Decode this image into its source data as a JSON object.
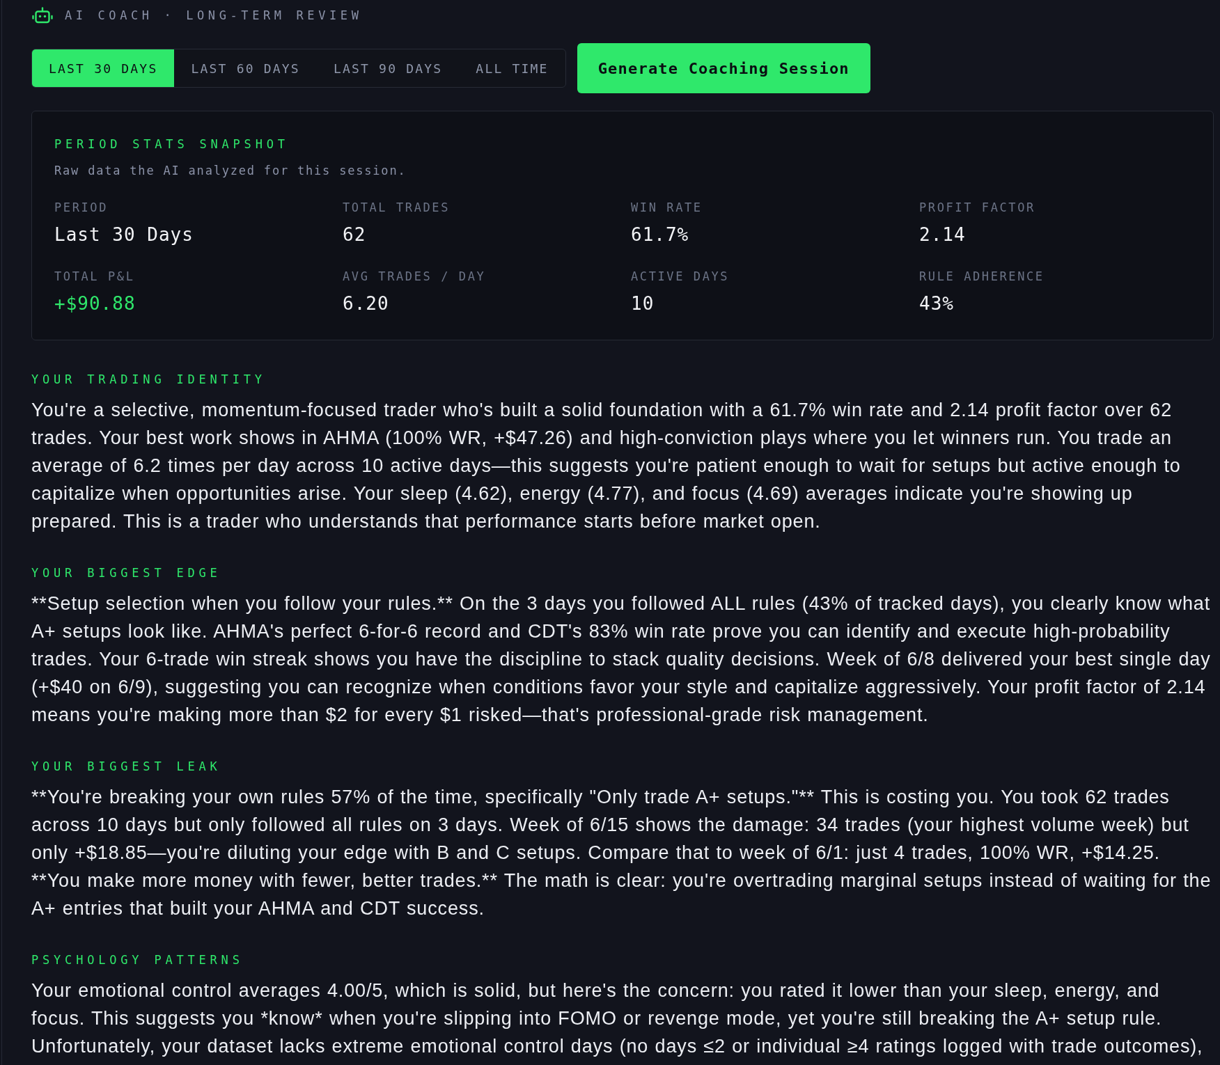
{
  "header": {
    "title": "AI COACH · LONG-TERM REVIEW"
  },
  "period_tabs": [
    {
      "label": "LAST 30 DAYS",
      "selected": true
    },
    {
      "label": "LAST 60 DAYS",
      "selected": false
    },
    {
      "label": "LAST 90 DAYS",
      "selected": false
    },
    {
      "label": "ALL TIME",
      "selected": false
    }
  ],
  "generate_button": {
    "label": "Generate Coaching Session"
  },
  "stats_snapshot": {
    "title": "PERIOD STATS SNAPSHOT",
    "subtitle": "Raw data the AI analyzed for this session.",
    "stats": [
      {
        "label": "PERIOD",
        "value": "Last 30 Days",
        "kind": "neutral"
      },
      {
        "label": "TOTAL TRADES",
        "value": "62",
        "kind": "neutral"
      },
      {
        "label": "WIN RATE",
        "value": "61.7%",
        "kind": "neutral"
      },
      {
        "label": "PROFIT FACTOR",
        "value": "2.14",
        "kind": "neutral"
      },
      {
        "label": "TOTAL P&L",
        "value": "+$90.88",
        "kind": "positive"
      },
      {
        "label": "AVG TRADES / DAY",
        "value": "6.20",
        "kind": "neutral"
      },
      {
        "label": "ACTIVE DAYS",
        "value": "10",
        "kind": "neutral"
      },
      {
        "label": "RULE ADHERENCE",
        "value": "43%",
        "kind": "neutral"
      }
    ]
  },
  "sections": [
    {
      "heading": "YOUR TRADING IDENTITY",
      "text": "You're a selective, momentum-focused trader who's built a solid foundation with a 61.7% win rate and 2.14 profit factor over 62 trades. Your best work shows in AHMA (100% WR, +$47.26) and high-conviction plays where you let winners run. You trade an average of 6.2 times per day across 10 active days—this suggests you're patient enough to wait for setups but active enough to capitalize when opportunities arise. Your sleep (4.62), energy (4.77), and focus (4.69) averages indicate you're showing up prepared. This is a trader who understands that performance starts before market open."
    },
    {
      "heading": "YOUR BIGGEST EDGE",
      "text": "**Setup selection when you follow your rules.** On the 3 days you followed ALL rules (43% of tracked days), you clearly know what A+ setups look like. AHMA's perfect 6-for-6 record and CDT's 83% win rate prove you can identify and execute high-probability trades. Your 6-trade win streak shows you have the discipline to stack quality decisions. Week of 6/8 delivered your best single day (+$40 on 6/9), suggesting you can recognize when conditions favor your style and capitalize aggressively. Your profit factor of 2.14 means you're making more than $2 for every $1 risked—that's professional-grade risk management."
    },
    {
      "heading": "YOUR BIGGEST LEAK",
      "text": "**You're breaking your own rules 57% of the time, specifically \"Only trade A+ setups.\"** This is costing you. You took 62 trades across 10 days but only followed all rules on 3 days. Week of 6/15 shows the damage: 34 trades (your highest volume week) but only +$18.85—you're diluting your edge with B and C setups. Compare that to week of 6/1: just 4 trades, 100% WR, +$14.25. **You make more money with fewer, better trades.** The math is clear: you're overtrading marginal setups instead of waiting for the A+ entries that built your AHMA and CDT success."
    },
    {
      "heading": "PSYCHOLOGY PATTERNS",
      "text": "Your emotional control averages 4.00/5, which is solid, but here's the concern: you rated it lower than your sleep, energy, and focus. This suggests you *know* when you're slipping into FOMO or revenge mode, yet you're still breaking the A+ setup rule. Unfortunately, your dataset lacks extreme emotional control days (no days ≤2 or individual ≥4 ratings logged with trade outcomes),"
    }
  ]
}
